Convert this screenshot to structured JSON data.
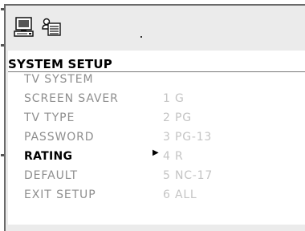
{
  "toolbar": {
    "icons": [
      "system-setup-icon",
      "preferences-icon"
    ]
  },
  "heading": "SYSTEM  SETUP",
  "menu": {
    "items": [
      {
        "label": "TV  SYSTEM"
      },
      {
        "label": "SCREEN  SAVER"
      },
      {
        "label": "TV  TYPE"
      },
      {
        "label": "PASSWORD"
      },
      {
        "label": "RATING"
      },
      {
        "label": "DEFAULT"
      },
      {
        "label": "EXIT  SETUP"
      }
    ],
    "active_item": "RATING",
    "arrow": "▶"
  },
  "rating_options": [
    {
      "label": "1 G"
    },
    {
      "label": "2 PG"
    },
    {
      "label": "3 PG-13"
    },
    {
      "label": "4 R"
    },
    {
      "label": "5 NC-17"
    },
    {
      "label": "6 ALL"
    }
  ],
  "colors": {
    "frame": "#ebebeb",
    "panel": "#ffffff",
    "active_text": "#000000",
    "inactive_text": "#8e8e8e",
    "option_text": "#c4c4c4"
  }
}
